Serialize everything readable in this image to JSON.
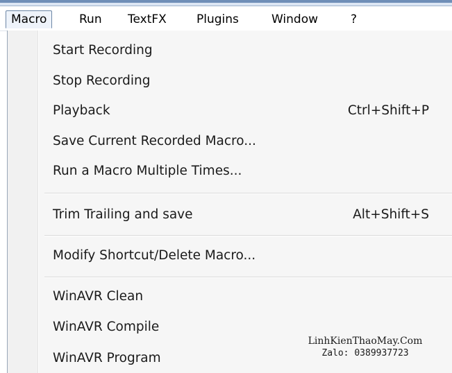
{
  "menubar": {
    "items": [
      {
        "label": "Macro",
        "active": true
      },
      {
        "label": "Run"
      },
      {
        "label": "TextFX"
      },
      {
        "label": "Plugins"
      },
      {
        "label": "Window"
      },
      {
        "label": "?"
      }
    ]
  },
  "menu": {
    "items": [
      {
        "label": "Start Recording",
        "shortcut": ""
      },
      {
        "label": "Stop Recording",
        "shortcut": ""
      },
      {
        "label": "Playback",
        "shortcut": "Ctrl+Shift+P"
      },
      {
        "label": "Save Current Recorded Macro...",
        "shortcut": ""
      },
      {
        "label": "Run a Macro Multiple Times...",
        "shortcut": ""
      },
      {
        "label": "Trim Trailing and save",
        "shortcut": "Alt+Shift+S"
      },
      {
        "label": "Modify Shortcut/Delete Macro...",
        "shortcut": ""
      },
      {
        "label": "WinAVR Clean",
        "shortcut": ""
      },
      {
        "label": "WinAVR Compile",
        "shortcut": ""
      },
      {
        "label": "WinAVR Program",
        "shortcut": ""
      }
    ]
  },
  "watermark": {
    "line1": "LinhKienThaoMay.Com",
    "line2": "Zalo: 0389937723"
  },
  "colors": {
    "active_menu_bg": "#eef3fa",
    "active_menu_border": "#6c86a6",
    "dropdown_bg": "#f6f6f6"
  }
}
